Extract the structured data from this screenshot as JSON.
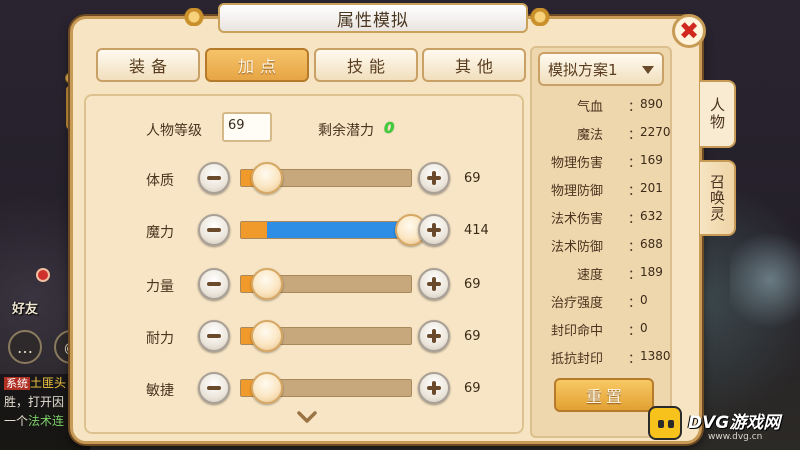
{
  "window": {
    "title": "属性模拟",
    "close_glyph": "✖"
  },
  "tabs": [
    {
      "label": "装备",
      "active": false
    },
    {
      "label": "加点",
      "active": true
    },
    {
      "label": "技能",
      "active": false
    },
    {
      "label": "其他",
      "active": false
    }
  ],
  "level": {
    "label": "人物等级",
    "value": "69"
  },
  "potential": {
    "label": "剩余潜力",
    "value": "0"
  },
  "attributes": [
    {
      "label": "体质",
      "value": "69",
      "fill_fraction": 0.06
    },
    {
      "label": "魔力",
      "value": "414",
      "fill_fraction": 1.0
    },
    {
      "label": "力量",
      "value": "69",
      "fill_fraction": 0.06
    },
    {
      "label": "耐力",
      "value": "69",
      "fill_fraction": 0.06
    },
    {
      "label": "敏捷",
      "value": "69",
      "fill_fraction": 0.06
    }
  ],
  "scheme": {
    "selected": "模拟方案1"
  },
  "stats": [
    {
      "name": "气血",
      "value": "890"
    },
    {
      "name": "魔法",
      "value": "2270"
    },
    {
      "name": "物理伤害",
      "value": "169"
    },
    {
      "name": "物理防御",
      "value": "201"
    },
    {
      "name": "法术伤害",
      "value": "632"
    },
    {
      "name": "法术防御",
      "value": "688"
    },
    {
      "name": "速度",
      "value": "189"
    },
    {
      "name": "治疗强度",
      "value": "0"
    },
    {
      "name": "封印命中",
      "value": "0"
    },
    {
      "name": "抵抗封印",
      "value": "1380"
    }
  ],
  "stat_separator": "：",
  "reset_label": "重置",
  "side_tabs": [
    {
      "label": "人物",
      "active": true
    },
    {
      "label": "召唤灵",
      "active": false
    }
  ],
  "hud": {
    "friends_label": "好友",
    "chat": {
      "system_tag": "系统",
      "line1": "土匪头",
      "line2": "胜，打开因",
      "line3_prefix": "一个",
      "line3_highlight": "法术连"
    }
  },
  "watermark": {
    "text": "DVG游戏网",
    "sub": "www.dvg.cn"
  },
  "colors": {
    "panel_bg": "#f6e4c2",
    "active_tab": "#e6a545",
    "magic_fill": "#2e8ee6",
    "base_fill": "#f09a2c",
    "potential_green": "#3ccf3a",
    "close_red": "#d0281f"
  }
}
